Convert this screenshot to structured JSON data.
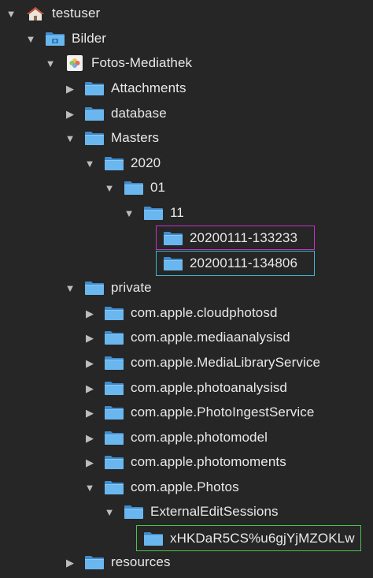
{
  "colors": {
    "magenta_box": "#c531c5",
    "cyan_box": "#3fb6cf",
    "green_box": "#49c44b",
    "folder_blue": "#4a9fdc"
  },
  "tree": {
    "root_user": "testuser",
    "bilder": "Bilder",
    "fotos": "Fotos-Mediathek",
    "attachments": "Attachments",
    "database": "database",
    "masters": "Masters",
    "y2020": "2020",
    "m01": "01",
    "d11": "11",
    "f133233": "20200111-133233",
    "f134806": "20200111-134806",
    "private": "private",
    "cloudphotosd": "com.apple.cloudphotosd",
    "mediaanalysisd": "com.apple.mediaanalysisd",
    "medialibraryservice": "com.apple.MediaLibraryService",
    "photoanalysisd": "com.apple.photoanalysisd",
    "photoingestservice": "com.apple.PhotoIngestService",
    "photomodel": "com.apple.photomodel",
    "photomoments": "com.apple.photomoments",
    "photos": "com.apple.Photos",
    "externaleditsessions": "ExternalEditSessions",
    "session_id": "xHKDaR5CS%u6gjYjMZOKLw",
    "resources": "resources"
  },
  "icons": {
    "home": "home-icon",
    "pictures_folder": "pictures-folder-icon",
    "photos_library": "photos-library-icon",
    "folder": "folder-icon",
    "expanded": "disclosure-expanded-icon",
    "collapsed": "disclosure-collapsed-icon"
  }
}
